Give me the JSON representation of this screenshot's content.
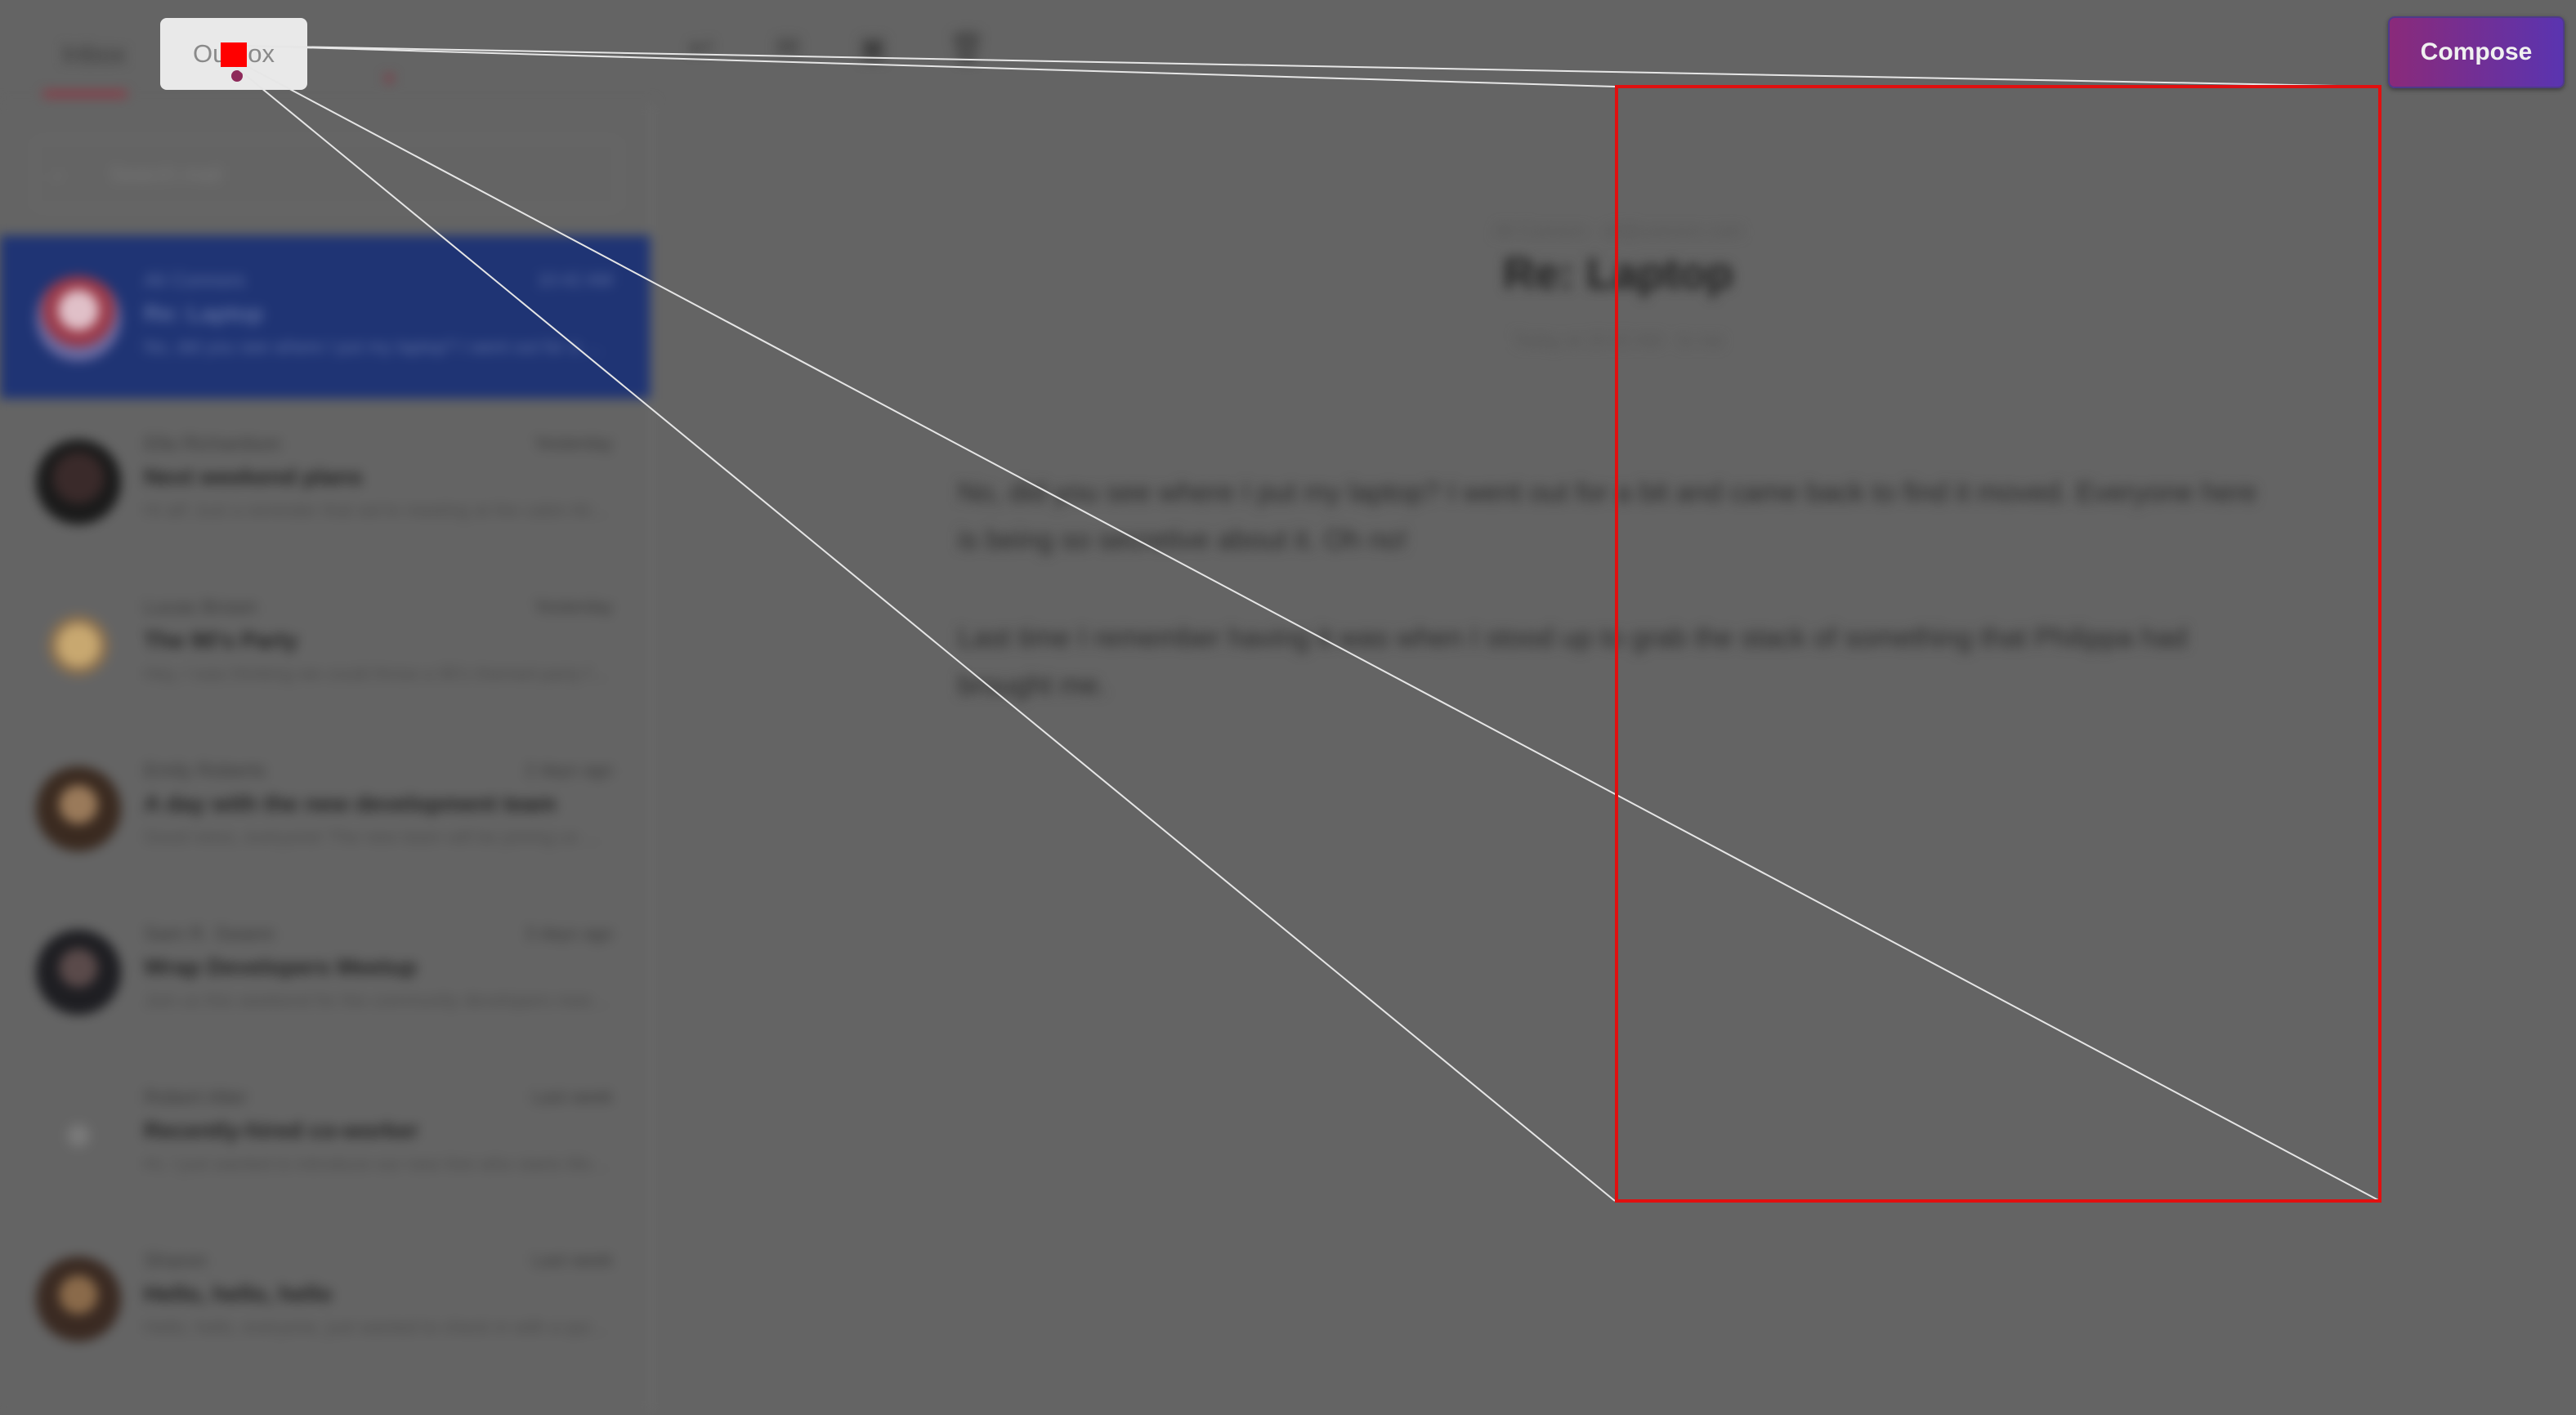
{
  "tabs": {
    "inbox_label": "Inbox",
    "outbox_label": "Outbox"
  },
  "toolbar": {
    "icons": [
      "reply-icon",
      "forward-icon",
      "archive-icon",
      "delete-icon"
    ],
    "compose_label": "Compose"
  },
  "search": {
    "placeholder": "Search mail"
  },
  "emails": [
    {
      "sender": "Ali Connors",
      "date": "10:42 AM",
      "subject": "Re: Laptop",
      "preview": "No, did you see where I put my laptop? I went out for a bit and came back..."
    },
    {
      "sender": "Ella Richardson",
      "date": "Yesterday",
      "subject": "Next weekend plans",
      "preview": "Hi all! Just a reminder that we're meeting at the cabin this Saturday..."
    },
    {
      "sender": "Lucas Brown",
      "date": "Yesterday",
      "subject": "The 90's Party",
      "preview": "Hey, I was thinking we could throw a 90's themed party for the office..."
    },
    {
      "sender": "Emily Roberts",
      "date": "2 days ago",
      "subject": "A day with the new development team",
      "preview": "Good news, everyone! The new team will be joining us next week..."
    },
    {
      "sender": "Sam R. Swann",
      "date": "3 days ago",
      "subject": "Wrap Developers Meetup",
      "preview": "Join us this weekend for the community developers meetup..."
    },
    {
      "sender": "Robert Alter",
      "date": "Last week",
      "subject": "Recently-hired co-worker",
      "preview": "Hi, I just wanted to introduce our new hire who starts Monday..."
    },
    {
      "sender": "Sharon",
      "date": "Last week",
      "subject": "Hello, hello, hello",
      "preview": "Hello, hello, everyone, just wanted to check in with a quick note..."
    }
  ],
  "reading": {
    "meta_top": "Ali Connors · ali@connors.com",
    "title": "Re: Laptop",
    "meta_bottom": "Today at 10:42 AM · to me",
    "body": [
      "No, did you see where I put my laptop? I went out for a bit and came back to find it moved. Everyone here is being so secretive about it. Oh no!",
      "Last time I remember having it was when I stood up to grab the stack of something that Philippa had brought me."
    ]
  },
  "colors": {
    "background": "#646464",
    "compose_gradient_start": "#8a2a7a",
    "compose_gradient_end": "#5a34b0",
    "selected_item": "#1f3474",
    "annotation_red": "#e01010",
    "annotation_line": "#e6e6e6"
  }
}
